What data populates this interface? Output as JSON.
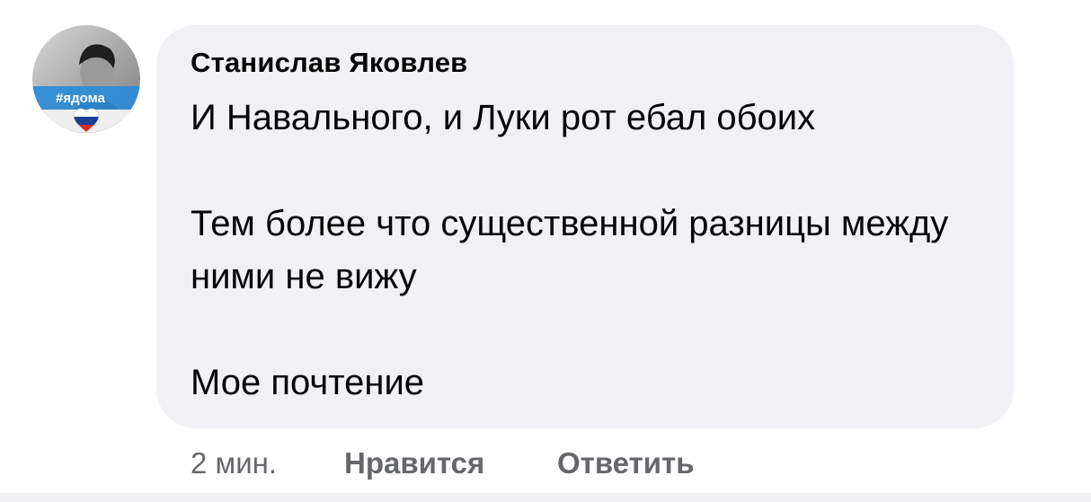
{
  "comment": {
    "author": "Станислав Яковлев",
    "avatar_badge": "#ядома",
    "paragraphs": [
      "И Навального, и Луки рот ебал обоих",
      "Тем более что существенной разницы между ними не вижу",
      "Мое почтение"
    ]
  },
  "actions": {
    "time": "2 мин.",
    "like_label": "Нравится",
    "reply_label": "Ответить"
  },
  "colors": {
    "bubble": "#f0f0f5",
    "text": "#050505",
    "secondary_text": "#65676b",
    "flag_white": "#ffffff",
    "flag_blue": "#1c3f94",
    "flag_red": "#d52b1e",
    "badge_band": "#2a8bd6"
  }
}
